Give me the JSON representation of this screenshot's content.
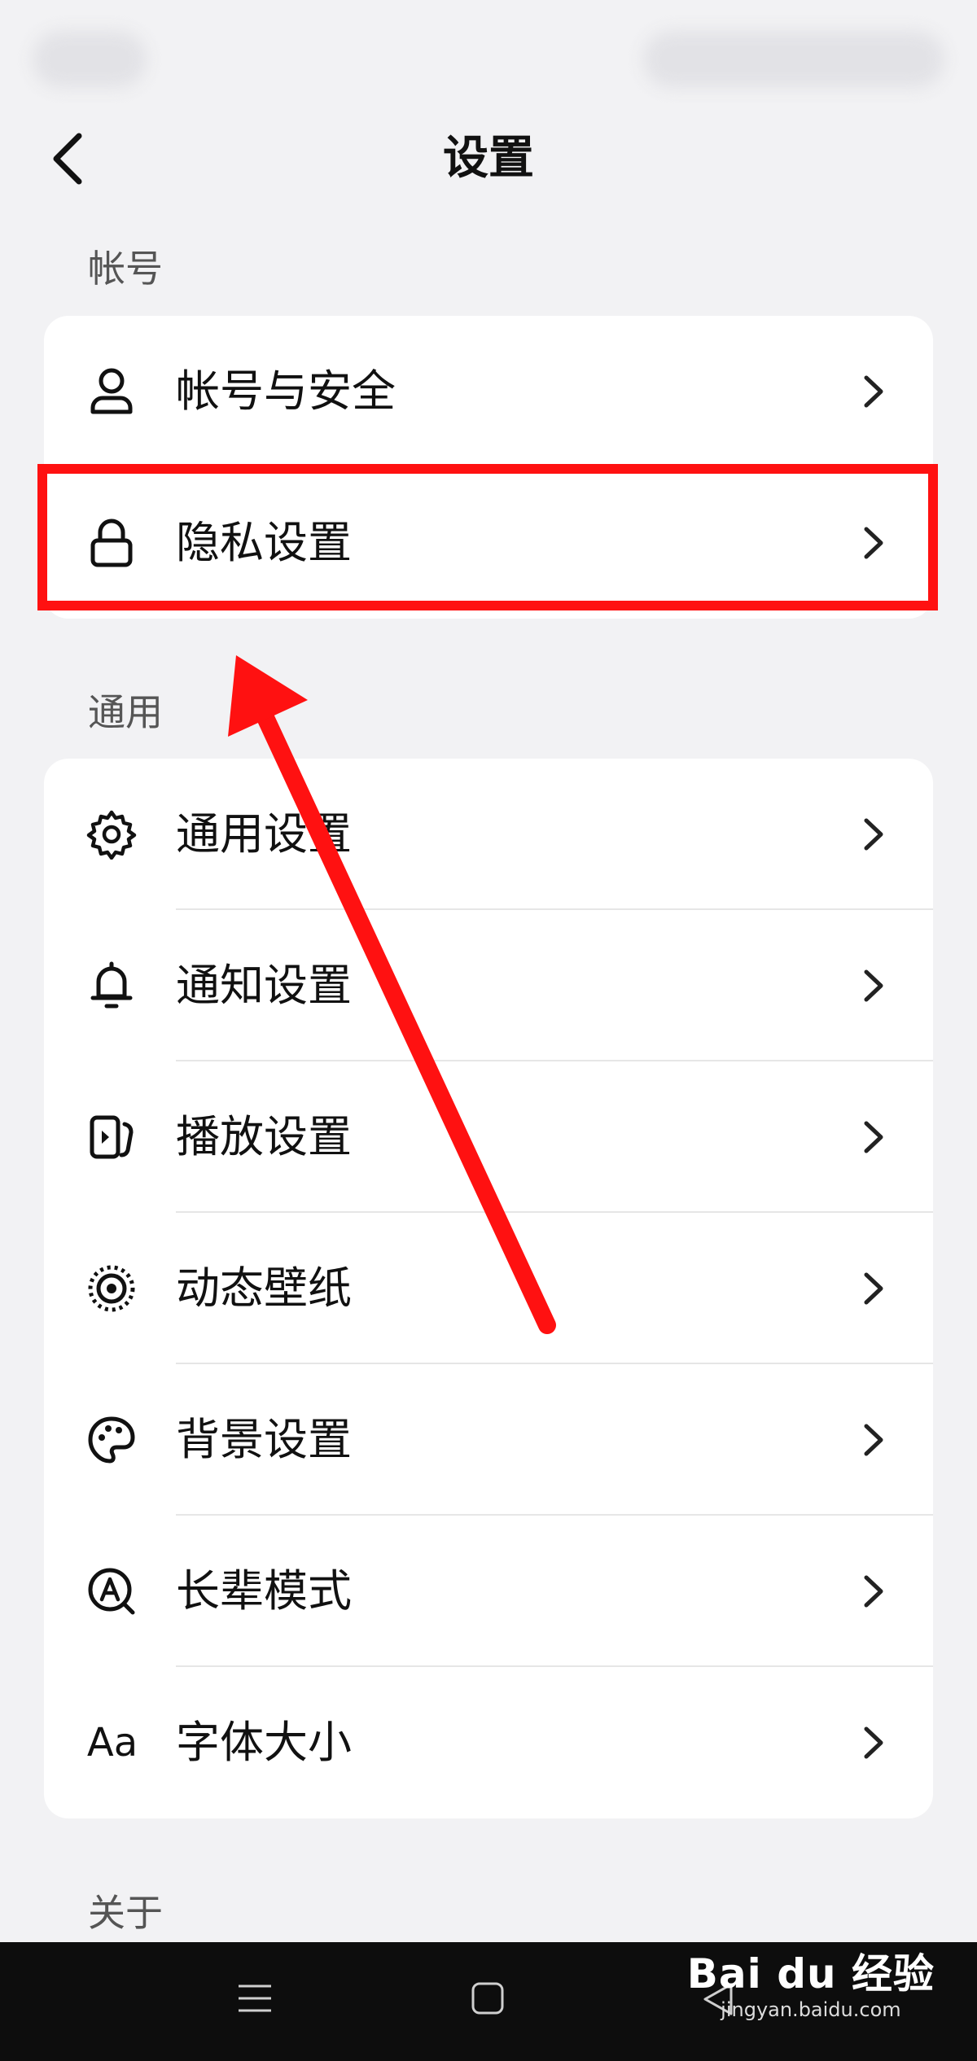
{
  "header": {
    "title": "设置"
  },
  "sections": {
    "account": {
      "title": "帐号",
      "items": [
        {
          "label": "帐号与安全",
          "icon": "user-icon"
        },
        {
          "label": "隐私设置",
          "icon": "lock-icon"
        }
      ]
    },
    "general": {
      "title": "通用",
      "items": [
        {
          "label": "通用设置",
          "icon": "gear-icon"
        },
        {
          "label": "通知设置",
          "icon": "bell-icon"
        },
        {
          "label": "播放设置",
          "icon": "play-icon"
        },
        {
          "label": "动态壁纸",
          "icon": "wallpaper-icon"
        },
        {
          "label": "背景设置",
          "icon": "palette-icon"
        },
        {
          "label": "长辈模式",
          "icon": "elder-mode-icon"
        },
        {
          "label": "字体大小",
          "icon": "font-size-icon",
          "icon_text": "Aa"
        }
      ]
    },
    "about": {
      "title": "关于"
    }
  },
  "annotation": {
    "color": "#ff1111"
  },
  "watermark": {
    "brand": "Bai du 经验",
    "url": "jingyan.baidu.com"
  }
}
